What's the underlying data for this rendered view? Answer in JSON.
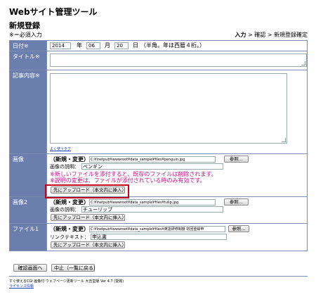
{
  "app_title": "Webサイト管理ツール",
  "page_title": "新規登録",
  "required_note": "※＝必須入力",
  "steps": {
    "current": "入力",
    "rest": " > 確認 > 新規登録確定"
  },
  "date": {
    "label": "日付※",
    "year": "2014",
    "year_unit": "年",
    "month": "06",
    "month_unit": "月",
    "day": "20",
    "day_unit": "日",
    "note": "（半角。年は西暦４桁。）"
  },
  "title_field": {
    "label": "タイトル※",
    "value": ""
  },
  "body_field": {
    "label": "記事内容※",
    "value": "",
    "link": "よく使うタグ"
  },
  "image1": {
    "label": "画像",
    "mode": "（新規・変更）",
    "path": "C:¥Inetpub¥wwwroot¥data_sample¥files¥penguin.jpg",
    "browse": "参照...",
    "desc_label": "画像の説明：",
    "desc_value": "ペンギン",
    "warn1": "※新しいファイルを添付すると、既存のファイルは削除されます。",
    "warn2": "※説明の変更は、ファイルが添付されている時のみ有効です。",
    "upload": "先にアップロード（本文内に挿入）"
  },
  "image2": {
    "label": "画像2",
    "mode": "（新規・変更）",
    "path": "C:¥Inetpub¥wwwroot¥data_sample¥files¥tulip.jpg",
    "browse": "参照...",
    "desc_label": "画像の説明：",
    "desc_value": "チューリップ",
    "upload": "先にアップロード（本文内に挿入）"
  },
  "file1": {
    "label": "ファイル1",
    "mode": "（新規・変更）",
    "path": "C:¥Inetpub¥wwwroot¥data_sample¥files¥英語研修制度 初回登録申",
    "browse": "参照...",
    "link_label": "リンクテキスト：",
    "link_value": "申込書",
    "upload": "先にアップロード（本文内に挿入）"
  },
  "actions": {
    "confirm": "確認画面へ",
    "cancel": "中止（一覧に戻る）"
  },
  "footer": {
    "line1": "すぐ使えるCGI 画像付 ウェブページ更新ツール 大吉堂版 Ver 4.7 (愛婉)",
    "license": "ライセンス情報"
  },
  "colors": {
    "label_bg": "#6b7fae",
    "border": "#7a8db0",
    "highlight": "#c8001c",
    "warning": "#c0168a",
    "link": "#1a3fb0"
  }
}
